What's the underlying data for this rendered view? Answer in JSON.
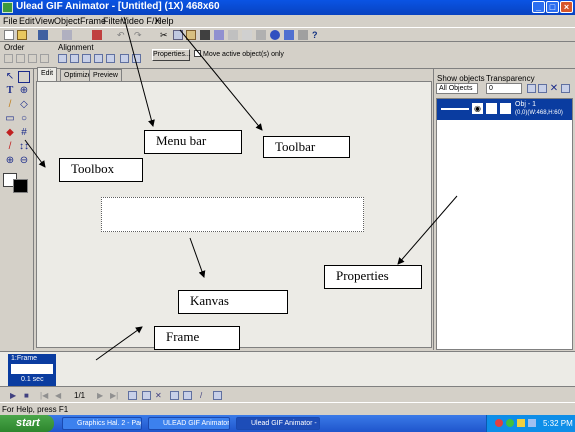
{
  "window": {
    "title": "Ulead GIF Animator - [Untitled] (1X) 468x60",
    "controls": [
      "_",
      "□",
      "×"
    ]
  },
  "menu": [
    "File",
    "Edit",
    "View",
    "Object",
    "Frame",
    "Filter",
    "Video F/X",
    "Help"
  ],
  "orderbar": {
    "order_label": "Order",
    "alignment_label": "Alignment",
    "properties_button": "Properties...",
    "move_option": "Move active object(s) only"
  },
  "tabs": [
    "Edit",
    "Optimize",
    "Preview"
  ],
  "objects_panel": {
    "show_objects_label": "Show objects",
    "transparency_label": "Transparency",
    "filter_value": "All Objects",
    "transparency_value": "0",
    "object": {
      "name": "Obj - 1",
      "geometry": "(0,0)(W:468,H:60)"
    }
  },
  "frames": [
    {
      "label": "1:Frame",
      "delay": "0.1 sec"
    }
  ],
  "playback": {
    "counter": "1/1"
  },
  "status": "For Help, press F1",
  "taskbar": {
    "start": "start",
    "tasks": [
      "Graphics Hal. 2 - Pag...",
      "ULEAD GIF Animator ...",
      "Ulead GIF Animator - ..."
    ],
    "clock": "5:32 PM"
  },
  "annotations": {
    "menu_bar": "Menu bar",
    "toolbar": "Toolbar",
    "toolbox": "Toolbox",
    "properties": "Properties",
    "kanvas": "Kanvas",
    "frame": "Frame"
  },
  "colors": {
    "title": "#0a54e4",
    "selection": "#0a3ca0",
    "taskbar": "#245edb",
    "start": "#3c9a3c"
  }
}
